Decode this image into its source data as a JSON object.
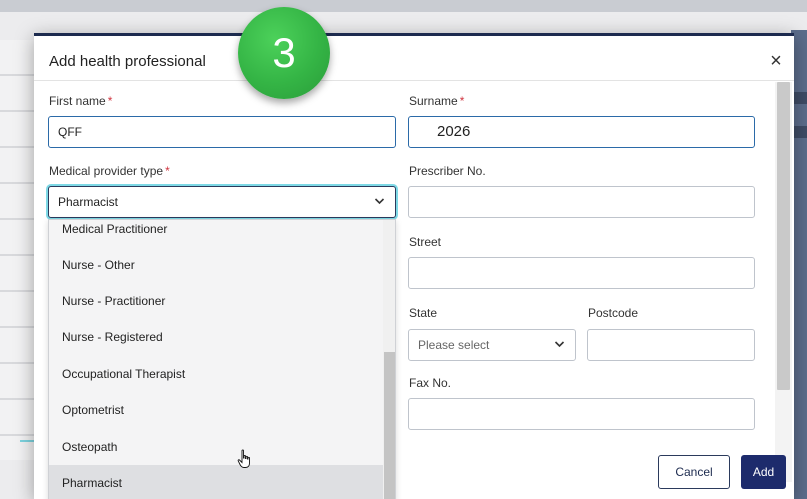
{
  "modal": {
    "title": "Add health professional",
    "close_glyph": "×"
  },
  "step_badge": "3",
  "form": {
    "first_name": {
      "label": "First name",
      "required_mark": "*",
      "value": "QFF"
    },
    "surname": {
      "label": "Surname",
      "required_mark": "*",
      "value": "2026"
    },
    "medical_provider_type": {
      "label": "Medical provider type",
      "required_mark": "*",
      "value": "Pharmacist",
      "chevron": "❯"
    },
    "prescriber_no": {
      "label": "Prescriber No.",
      "value": ""
    },
    "street": {
      "label": "Street",
      "value": ""
    },
    "state": {
      "label": "State",
      "placeholder": "Please select",
      "chevron": "❯"
    },
    "postcode": {
      "label": "Postcode",
      "value": ""
    },
    "fax_no": {
      "label": "Fax No.",
      "value": ""
    }
  },
  "dropdown": {
    "options": [
      "Medical Practitioner",
      "Nurse - Other",
      "Nurse - Practitioner",
      "Nurse - Registered",
      "Occupational Therapist",
      "Optometrist",
      "Osteopath",
      "Pharmacist"
    ],
    "highlighted": "Pharmacist"
  },
  "footer": {
    "cancel_label": "Cancel",
    "add_label": "Add"
  },
  "icons": {
    "close": "close-icon",
    "chevron": "chevron-down-icon",
    "cursor": "hand-pointer-icon"
  },
  "colors": {
    "primary": "#1d2b6c",
    "focus_ring": "#7ed9e6",
    "required": "#d0343f",
    "badge": "#34b445"
  }
}
